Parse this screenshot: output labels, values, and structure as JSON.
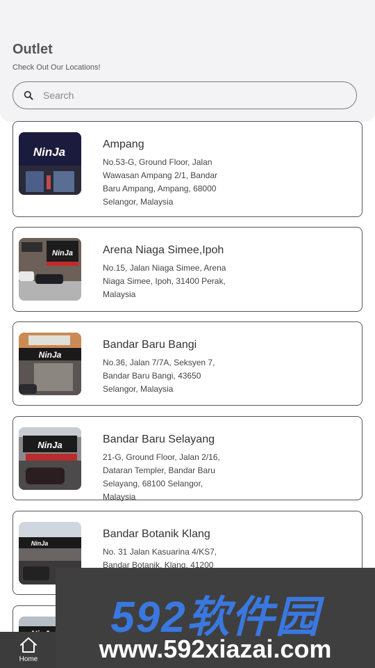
{
  "header": {
    "title": "Outlet",
    "subtitle": "Check Out Our Locations!"
  },
  "search": {
    "placeholder": "Search",
    "value": ""
  },
  "outlets": [
    {
      "name": "Ampang",
      "address": "No.53-G, Ground Floor, Jalan Wawasan Ampang 2/1, Bandar Baru Ampang, Ampang, 68000 Selangor, Malaysia",
      "sign": "NinJa"
    },
    {
      "name": "Arena Niaga Simee,Ipoh",
      "address": "No.15, Jalan Niaga Simee, Arena Niaga Simee, Ipoh, 31400 Perak, Malaysia",
      "sign": "NinJa"
    },
    {
      "name": "Bandar Baru Bangi",
      "address": "No.36, Jalan 7/7A, Seksyen 7, Bandar Baru Bangi, 43650 Selangor, Malaysia",
      "sign": "NinJa"
    },
    {
      "name": "Bandar Baru Selayang",
      "address": "21-G, Ground Floor, Jalan 2/16, Dataran Templer, Bandar Baru Selayang, 68100 Selangor, Malaysia",
      "sign": "NinJa"
    },
    {
      "name": "Bandar Botanik Klang",
      "address": "No. 31 Jalan Kasuarina 4/KS7, Bandar Botanik, Klang, 41200",
      "sign": "NinJa"
    },
    {
      "name": "",
      "address": "",
      "sign": "NinJa"
    }
  ],
  "nav": {
    "home_label": "Home"
  },
  "watermark": {
    "brand": "592软件园",
    "url": "www.592xiazai.com"
  },
  "icons": {
    "search": "search-icon",
    "home": "home-icon"
  },
  "colors": {
    "header_bg": "#f3f3f5",
    "card_border": "#555555",
    "nav_bg": "#3c3c3c",
    "watermark_brand": "#3a78e0"
  }
}
